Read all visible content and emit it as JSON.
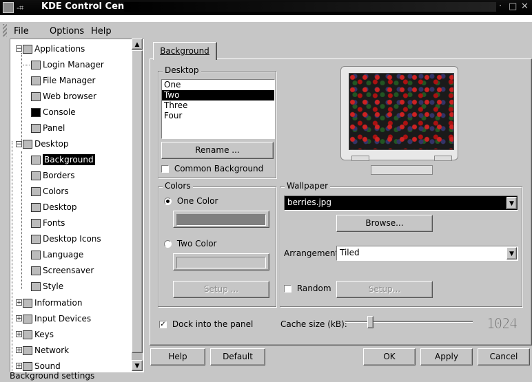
{
  "window": {
    "title": "KDE Control Center"
  },
  "menu": {
    "file": "File",
    "options": "Options",
    "help": "Help"
  },
  "tree": {
    "applications": "Applications",
    "login_manager": "Login Manager",
    "file_manager": "File Manager",
    "web_browser": "Web browser",
    "console": "Console",
    "panel": "Panel",
    "desktop": "Desktop",
    "background": "Background",
    "borders": "Borders",
    "colors": "Colors",
    "desktop_sub": "Desktop",
    "fonts": "Fonts",
    "desktop_icons": "Desktop Icons",
    "language": "Language",
    "screensaver": "Screensaver",
    "style": "Style",
    "information": "Information",
    "input_devices": "Input Devices",
    "keys": "Keys",
    "network": "Network",
    "sound": "Sound"
  },
  "tab": {
    "label": "Background"
  },
  "desktop_group": {
    "label": "Desktop",
    "items": [
      "One",
      "Two",
      "Three",
      "Four"
    ],
    "selected": "Two",
    "rename_button": "Rename ...",
    "common_background": "Common Background"
  },
  "colors_group": {
    "label": "Colors",
    "one_color": "One Color",
    "two_color": "Two Color",
    "setup_button": "Setup ...",
    "color1": "#808080"
  },
  "wallpaper_group": {
    "label": "Wallpaper",
    "file": "berries.jpg",
    "browse_button": "Browse...",
    "arrangement_label": "Arrangement:",
    "arrangement_value": "Tiled",
    "random_label": "Random",
    "setup_button": "Setup..."
  },
  "dock": {
    "label": "Dock into the panel"
  },
  "cache": {
    "label": "Cache size (kB):",
    "value": "1024"
  },
  "buttons": {
    "help": "Help",
    "default": "Default",
    "ok": "OK",
    "apply": "Apply",
    "cancel": "Cancel"
  },
  "status": {
    "text": "Background settings"
  }
}
